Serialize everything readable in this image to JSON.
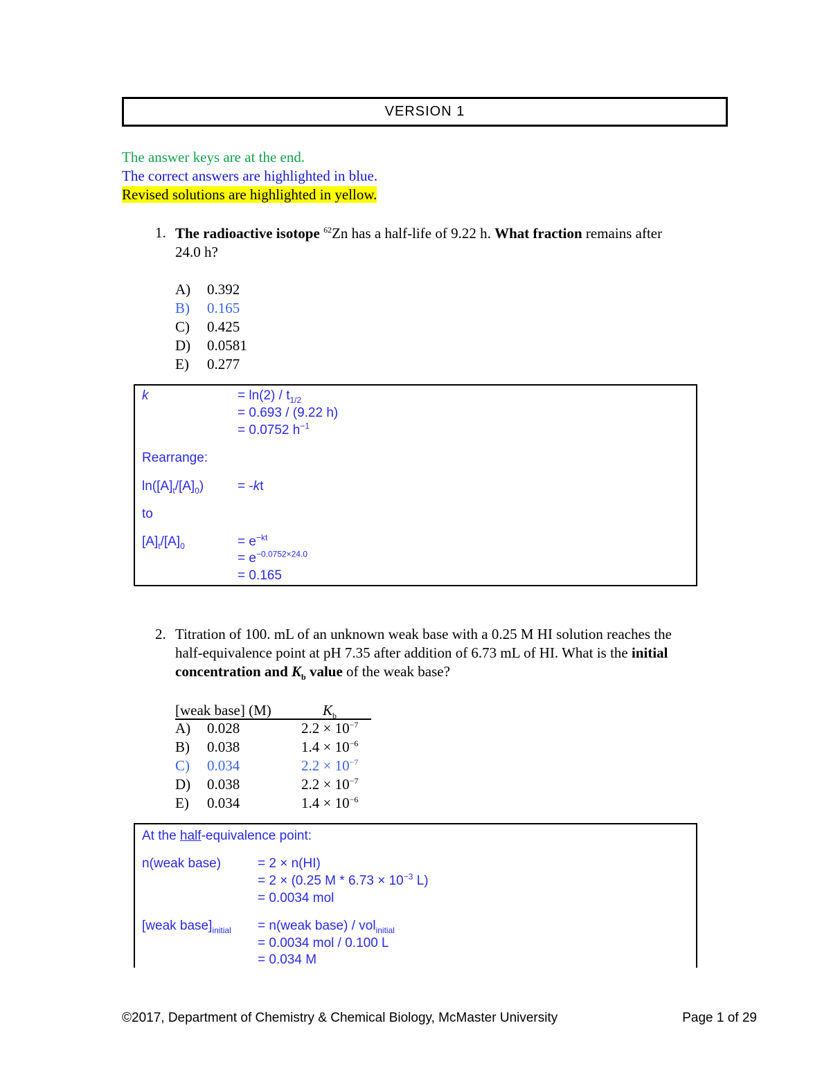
{
  "header": {
    "version": "VERSION 1"
  },
  "notes": {
    "answer_keys": "The answer keys are at the end.",
    "correct": "The correct answers are highlighted in blue.",
    "revised": "Revised solutions are highlighted in yellow."
  },
  "colors": {
    "green_note": "#14a04a",
    "blue_note": "#1515c8",
    "highlight": "#ffff00",
    "correct_answer": "#3a64e0",
    "solution_text": "#2a2ae0"
  },
  "q1": {
    "number": "1.",
    "b1": "The radioactive isotope ",
    "sup": "62",
    "t1": "Zn has a half-life of 9.22 h. ",
    "b2": "What fraction",
    "t2": " remains after",
    "line2": "24.0 h?",
    "options": [
      {
        "letter": "A)",
        "value": "0.392"
      },
      {
        "letter": "B)",
        "value": "0.165",
        "correct": true
      },
      {
        "letter": "C)",
        "value": "0.425"
      },
      {
        "letter": "D)",
        "value": "0.0581"
      },
      {
        "letter": "E)",
        "value": "0.277"
      }
    ],
    "solution": {
      "k": "k",
      "k_eq1a": "= ln(2) / t",
      "k_eq1sub": "1/2",
      "k_eq2": "= 0.693 / (9.22 h)",
      "k_eq3": "= 0.0752 h",
      "k_eq3sup": "−1",
      "rearrange": "Rearrange:",
      "ln_lhs_a": "ln([A]",
      "ln_lhs_sub1": "t",
      "ln_lhs_b": "/[A]",
      "ln_lhs_sub2": "0",
      "ln_lhs_c": ")",
      "ln_rhs_a": "= -",
      "ln_rhs_k": "k",
      "ln_rhs_b": "t",
      "to": "to",
      "r_lhs_a": "[A]",
      "r_lhs_sub1": "t",
      "r_lhs_b": "/[A]",
      "r_lhs_sub2": "0",
      "r_eq1": "=  e",
      "r_eq1sup": "−kt",
      "r_eq2": "=  e",
      "r_eq2sup": "−0.0752×24.0",
      "r_eq3": "=  0.165"
    }
  },
  "q2": {
    "number": "2.",
    "line1": "Titration of 100. mL of an unknown weak base with a 0.25 M HI solution reaches the",
    "line2a": "half-equivalence point at pH 7.35 after addition of 6.73 mL of HI.  What is the ",
    "line2b": "initial",
    "line3a": "concentration and ",
    "line3k": "K",
    "line3sub": "b",
    "line3b": " value",
    "line3c": " of the weak base?",
    "col1": "[weak base] (M)",
    "col2": "K",
    "col2sub": "b",
    "options": [
      {
        "letter": "A)",
        "value": "0.028",
        "kb": "2.2 × 10",
        "exp": "−7"
      },
      {
        "letter": "B)",
        "value": "0.038",
        "kb": "1.4 × 10",
        "exp": "−6"
      },
      {
        "letter": "C)",
        "value": "0.034",
        "kb": "2.2 × 10",
        "exp": "−7",
        "correct": true
      },
      {
        "letter": "D)",
        "value": "0.038",
        "kb": "2.2 × 10",
        "exp": "−7"
      },
      {
        "letter": "E)",
        "value": "0.034",
        "kb": "1.4 × 10",
        "exp": "−6"
      }
    ],
    "solution": {
      "at_a": "At the ",
      "at_u": "half",
      "at_b": "-equivalence point:",
      "n_lhs": "n(weak base)",
      "n_eq1": "= 2 × n(HI)",
      "n_eq2a": "= 2 × (0.25 M * 6.73 × 10",
      "n_eq2sup": "−3",
      "n_eq2b": " L)",
      "n_eq3": "= 0.0034 mol",
      "c_lhs": "[weak base]",
      "c_lhs_sub": "initial",
      "c_eq1": "= n(weak base) / vol",
      "c_eq1sub": "initial",
      "c_eq2": "= 0.0034 mol / 0.100 L",
      "c_eq3": "= 0.034 M"
    }
  },
  "footer": {
    "copyright": "©2017, Department of Chemistry & Chemical Biology, McMaster University",
    "page": "Page 1 of 29"
  }
}
